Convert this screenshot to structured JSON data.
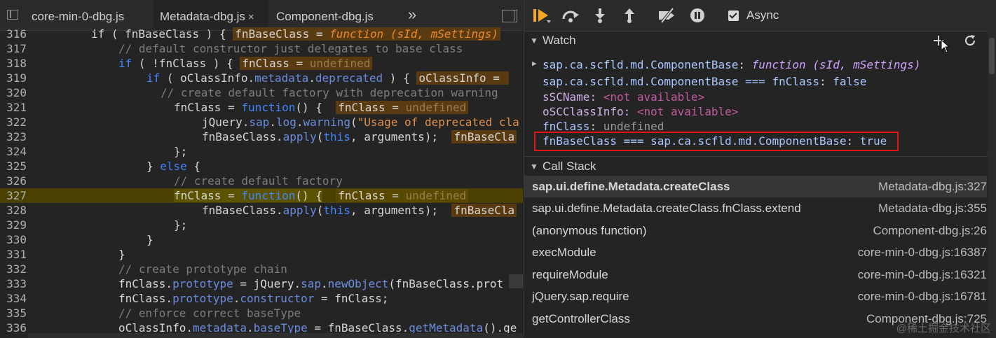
{
  "tabs": [
    {
      "label": "core-min-0-dbg.js",
      "active": false
    },
    {
      "label": "Metadata-dbg.js",
      "active": true,
      "close": "×"
    },
    {
      "label": "Component-dbg.js",
      "active": false
    }
  ],
  "tabs_more": "»",
  "code_lines": [
    {
      "num": "316"
    },
    {
      "num": "317"
    },
    {
      "num": "318"
    },
    {
      "num": "319"
    },
    {
      "num": "320"
    },
    {
      "num": "321"
    },
    {
      "num": "322"
    },
    {
      "num": "323"
    },
    {
      "num": "324"
    },
    {
      "num": "325"
    },
    {
      "num": "326"
    },
    {
      "num": "327"
    },
    {
      "num": "328"
    },
    {
      "num": "329"
    },
    {
      "num": "330"
    },
    {
      "num": "331"
    },
    {
      "num": "332"
    },
    {
      "num": "333"
    },
    {
      "num": "334"
    },
    {
      "num": "335"
    },
    {
      "num": "336"
    }
  ],
  "code": {
    "l316": {
      "a": "if ( fnBaseClass ) {",
      "b": "fnBaseClass = ",
      "c": "function (sId, mSettings)"
    },
    "l317": "// default constructor just delegates to base class",
    "l318": {
      "a": "( !fnClass ) {",
      "b": "fnClass = ",
      "c": "undefined"
    },
    "l319": {
      "a": "( oClassInfo.",
      "b": "metadata",
      "c": ".",
      "d": "deprecated",
      "e": " ) {",
      "f": "oClassInfo = "
    },
    "l320": "// create default factory with deprecation warning",
    "l321": {
      "a": "fnClass = ",
      "b": "function",
      "c": "() {",
      "d": "fnClass = ",
      "e": "undefined"
    },
    "l322": {
      "a": "jQuery.",
      "b": "sap",
      "c": ".",
      "d": "log",
      "e": ".",
      "f": "warning",
      "g": "(",
      "h": "\"Usage of deprecated cla"
    },
    "l323": {
      "a": "fnBaseClass.",
      "b": "apply",
      "c": "(",
      "d": "this",
      "e": ", arguments);",
      "f": "fnBaseCla"
    },
    "l324": "};",
    "l325": {
      "a": "} ",
      "b": "else",
      "c": " {"
    },
    "l326": "// create default factory",
    "l327": {
      "a": "fnClass",
      "b": " = ",
      "c": "function",
      "d": "() {",
      "e": "fnClass = ",
      "f": "undefined"
    },
    "l328": {
      "a": "fnBaseClass.",
      "b": "apply",
      "c": "(",
      "d": "this",
      "e": ", arguments);",
      "f": "fnBaseCla"
    },
    "l329": "};",
    "l330": "}",
    "l331": "}",
    "l332": "// create prototype chain",
    "l333": {
      "a": "fnClass.",
      "b": "prototype",
      "c": " = jQuery.",
      "d": "sap",
      "e": ".",
      "f": "newObject",
      "g": "(fnBaseClass.prot"
    },
    "l334": {
      "a": "fnClass.",
      "b": "prototype",
      "c": ".",
      "d": "constructor",
      "e": " = fnClass;"
    },
    "l335": "// enforce correct baseType",
    "l336": {
      "a": "oClassInfo.",
      "b": "metadata",
      "c": ".",
      "d": "baseType",
      "e": " = fnBaseClass.",
      "f": "getMetadata",
      "g": "().ge"
    }
  },
  "debugger": {
    "async_label": "Async",
    "async_checked": true,
    "icons": [
      "resume-icon",
      "step-over-icon",
      "step-into-icon",
      "step-out-icon",
      "deactivate-breakpoints-icon",
      "pause-on-exceptions-icon"
    ]
  },
  "watch": {
    "title": "Watch",
    "items": [
      {
        "key": "sap.ca.scfld.md.ComponentBase",
        "sep": ": ",
        "value": "function (sId, mSettings)"
      },
      {
        "key": "sap.ca.scfld.md.ComponentBase === fnClass",
        "sep": ": ",
        "value": "false"
      },
      {
        "key": "sSCName",
        "sep": ": ",
        "value": "<not available>"
      },
      {
        "key": "oSCClassInfo",
        "sep": ": ",
        "value": "<not available>"
      },
      {
        "key": "fnClass",
        "sep": ": ",
        "value": "undefined"
      },
      {
        "key": "fnBaseClass === sap.ca.scfld.md.ComponentBase",
        "sep": ": ",
        "value": "true"
      }
    ]
  },
  "call_stack": {
    "title": "Call Stack",
    "frames": [
      {
        "name": "sap.ui.define.Metadata.createClass",
        "loc": "Metadata-dbg.js:327",
        "selected": true
      },
      {
        "name": "sap.ui.define.Metadata.createClass.fnClass.extend",
        "loc": "Metadata-dbg.js:355"
      },
      {
        "name": "(anonymous function)",
        "loc": "Component-dbg.js:26"
      },
      {
        "name": "execModule",
        "loc": "core-min-0-dbg.js:16387"
      },
      {
        "name": "requireModule",
        "loc": "core-min-0-dbg.js:16321"
      },
      {
        "name": "jQuery.sap.require",
        "loc": "core-min-0-dbg.js:16781"
      },
      {
        "name": "getControllerClass",
        "loc": "Component-dbg.js:725"
      }
    ]
  },
  "watermark": "@稀土掘金技术社区",
  "colors": {
    "highlight_border": "#e01414",
    "paused_line": "#4a4000",
    "accent_resume": "#f5a623"
  }
}
